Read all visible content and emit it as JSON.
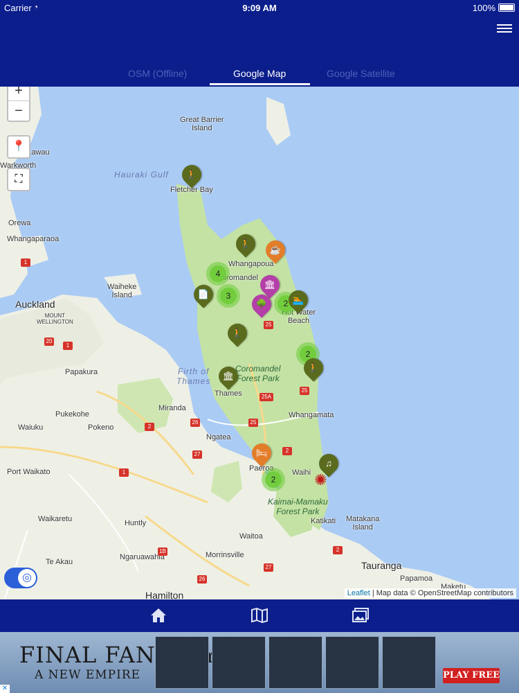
{
  "status_bar": {
    "carrier": "Carrier",
    "time": "9:09 AM",
    "battery": "100%"
  },
  "tabs": [
    {
      "label": "OSM (Offline)",
      "active": false
    },
    {
      "label": "Google Map",
      "active": true
    },
    {
      "label": "Google Satellite",
      "active": false
    }
  ],
  "map": {
    "controls": {
      "zoom_in": "+",
      "zoom_out": "−"
    },
    "places": {
      "great_barrier": "Great Barrier\nIsland",
      "hauraki_gulf": "Hauraki Gulf",
      "fletcher_bay": "Fletcher Bay",
      "kawau": "Kawau",
      "warkworth": "Warkworth",
      "orewa": "Orewa",
      "whangaparaoa": "Whangaparaoa",
      "whangapoua": "Whangapoua",
      "coromandel": "Coromandel",
      "waiheke": "Waiheke\nIsland",
      "auckland": "Auckland",
      "mount_wellington": "MOUNT\nWELLINGTON",
      "hot_water_beach": "Hot Water\nBeach",
      "papakura": "Papakura",
      "firth_of_thames": "Firth of\nThames",
      "coromandel_forest": "Coromandel\nForest Park",
      "thames": "Thames",
      "pukekohe": "Pukekohe",
      "miranda": "Miranda",
      "waiuku": "Waiuku",
      "pokeno": "Pokeno",
      "whangamata": "Whangamata",
      "ngatea": "Ngatea",
      "port_waikato": "Port Waikato",
      "paeroa": "Paeroa",
      "waihi": "Waihi",
      "kaimai_forest": "Kaimai-Mamaku\nForest Park",
      "katikati": "Katikati",
      "matakana": "Matakana\nIsland",
      "waikaretu": "Waikaretu",
      "huntly": "Huntly",
      "waitoa": "Waitoa",
      "te_akau": "Te Akau",
      "ngaruawahia": "Ngaruawahia",
      "morrinsville": "Morrinsville",
      "tauranga": "Tauranga",
      "papamoa": "Papamoa",
      "maketu": "Maketu",
      "hamilton": "Hamilton"
    },
    "roads": [
      "1",
      "20",
      "1",
      "25",
      "25",
      "25A",
      "25",
      "2",
      "26",
      "27",
      "2",
      "1B",
      "26",
      "27",
      "1",
      "2"
    ],
    "clusters": [
      "4",
      "3",
      "2",
      "2",
      "2"
    ],
    "markers": [
      {
        "type": "olive",
        "icon": "walking-icon"
      },
      {
        "type": "olive",
        "icon": "walking-icon"
      },
      {
        "type": "orange",
        "icon": "cafe-icon"
      },
      {
        "type": "purple",
        "icon": "museum-icon"
      },
      {
        "type": "purple",
        "icon": "tree-icon"
      },
      {
        "type": "olive",
        "icon": "swimming-icon"
      },
      {
        "type": "olive",
        "icon": "document-icon"
      },
      {
        "type": "olive",
        "icon": "walking-icon"
      },
      {
        "type": "olive",
        "icon": "museum-icon"
      },
      {
        "type": "olive",
        "icon": "walking-icon"
      },
      {
        "type": "orange",
        "icon": "bed-icon"
      },
      {
        "type": "olive",
        "icon": "music-icon"
      }
    ],
    "attribution": {
      "leaflet": "Leaflet",
      "rest": " | Map data © OpenStreetMap contributors"
    }
  },
  "nav": {
    "items": [
      "home-icon",
      "map-icon",
      "gallery-icon"
    ]
  },
  "ad": {
    "title": "FINAL FANTASY XV",
    "subtitle": "A NEW EMPIRE",
    "cta": "PLAY FREE",
    "close": "✕"
  },
  "colors": {
    "header": "#0b1e8c",
    "water": "#aacbf4",
    "land": "#eef0e6",
    "park": "#c4e2a4",
    "cluster": "#6ecc39"
  }
}
